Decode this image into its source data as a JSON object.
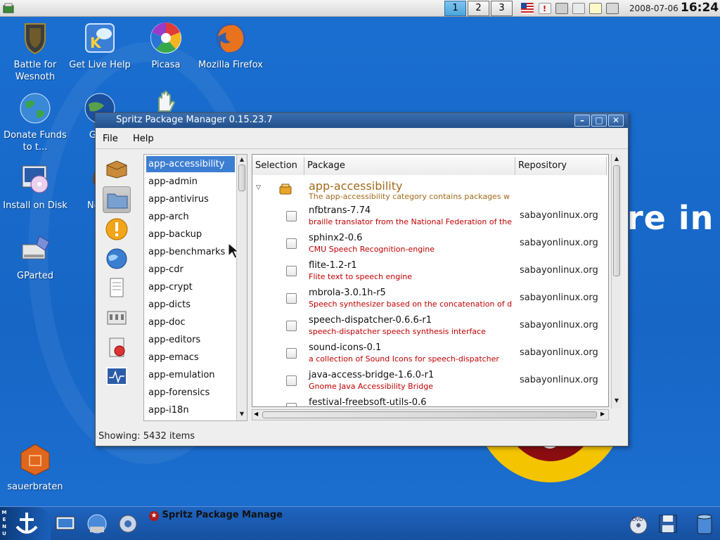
{
  "panel": {
    "workspaces": [
      "1",
      "2",
      "3"
    ],
    "date": "2008-07-06",
    "time": "16:24"
  },
  "desktop": {
    "icons": [
      {
        "label": "Battle for Wesnoth",
        "icon": "wesnoth-shield-icon"
      },
      {
        "label": "Get Live Help",
        "icon": "chat-bubble-icon"
      },
      {
        "label": "Picasa",
        "icon": "picasa-icon"
      },
      {
        "label": "Mozilla Firefox",
        "icon": "firefox-icon"
      },
      {
        "label": "Donate Funds to t...",
        "icon": "globe-icon"
      },
      {
        "label": "Go E",
        "icon": "google-earth-icon"
      },
      {
        "label": "Install on Disk",
        "icon": "install-disk-icon"
      },
      {
        "label": "Ne (C",
        "icon": "network-icon"
      },
      {
        "label": "GParted",
        "icon": "gparted-icon"
      },
      {
        "label": "sauerbraten",
        "icon": "sauerbraten-cube-icon"
      }
    ],
    "wallpaper_text": "re in"
  },
  "window": {
    "title": "Spritz Package Manager 0.15.23.7",
    "menu": {
      "file": "File",
      "help": "Help"
    },
    "categories": [
      "app-accessibility",
      "app-admin",
      "app-antivirus",
      "app-arch",
      "app-backup",
      "app-benchmarks",
      "app-cdr",
      "app-crypt",
      "app-dicts",
      "app-doc",
      "app-editors",
      "app-emacs",
      "app-emulation",
      "app-forensics",
      "app-i18n"
    ],
    "selected_category": "app-accessibility",
    "columns": {
      "selection": "Selection",
      "package": "Package",
      "repository": "Repository"
    },
    "group": {
      "name": "app-accessibility",
      "description": "The app-accessibility category contains packages w"
    },
    "packages": [
      {
        "name": "nfbtrans-7.74",
        "desc": "braille translator from the National Federation of the",
        "repo": "sabayonlinux.org"
      },
      {
        "name": "sphinx2-0.6",
        "desc": "CMU Speech Recognition-engine",
        "repo": "sabayonlinux.org"
      },
      {
        "name": "flite-1.2-r1",
        "desc": "Flite text to speech engine",
        "repo": "sabayonlinux.org"
      },
      {
        "name": "mbrola-3.0.1h-r5",
        "desc": "Speech synthesizer based on the concatenation of d",
        "repo": "sabayonlinux.org"
      },
      {
        "name": "speech-dispatcher-0.6.6-r1",
        "desc": "speech-dispatcher speech synthesis interface",
        "repo": "sabayonlinux.org"
      },
      {
        "name": "sound-icons-0.1",
        "desc": "a collection of Sound Icons for speech-dispatcher",
        "repo": "sabayonlinux.org"
      },
      {
        "name": "java-access-bridge-1.6.0-r1",
        "desc": "Gnome Java Accessibility Bridge",
        "repo": "sabayonlinux.org"
      },
      {
        "name": "festival-freebsoft-utils-0.6",
        "desc": "",
        "repo": ""
      }
    ],
    "status": "Showing: 5432 items"
  },
  "taskbar": {
    "menu_letters": [
      "M",
      "E",
      "N",
      "U"
    ],
    "task_label": "Spritz Package Manage"
  },
  "colors": {
    "desktop": "#1a6fd0",
    "selection": "#3c7ed1",
    "group_text": "#a36a1b",
    "pkg_desc": "#c00000"
  }
}
